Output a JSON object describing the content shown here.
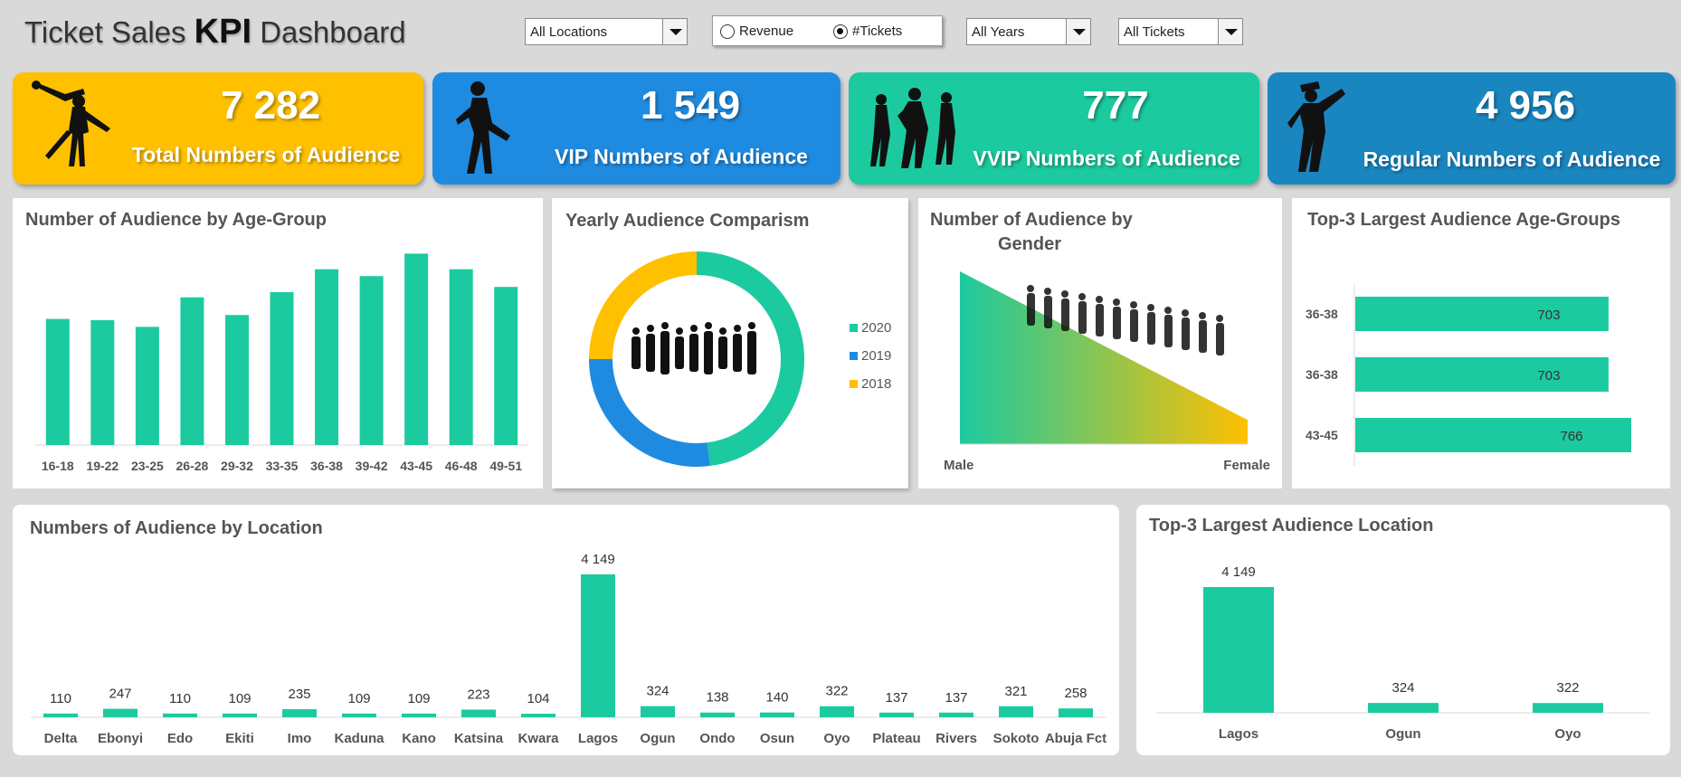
{
  "header": {
    "title_prefix": "Ticket Sales ",
    "title_bold": "KPI",
    "title_suffix": " Dashboard"
  },
  "filters": {
    "location": "All Locations",
    "years": "All Years",
    "tickets": "All Tickets",
    "metric_options": [
      "Revenue",
      "#Tickets"
    ],
    "metric_selected": "#Tickets"
  },
  "kpis": [
    {
      "value": "7 282",
      "label": "Total Numbers of Audience",
      "color": "#ffc000",
      "icon": "couple-dancer-silhouette-icon"
    },
    {
      "value": "1 549",
      "label": "VIP Numbers of Audience",
      "color": "#1f8be0",
      "icon": "male-dancer-silhouette-icon"
    },
    {
      "value": "777",
      "label": "VVIP Numbers of Audience",
      "color": "#1ccaa0",
      "icon": "group-dancers-silhouette-icon"
    },
    {
      "value": "4 956",
      "label": "Regular Numbers of Audience",
      "color": "#1a86c0",
      "icon": "hiphop-dancer-silhouette-icon"
    }
  ],
  "colors": {
    "accent": "#1ccaa0",
    "blue": "#1f8be0",
    "yellow": "#ffc000"
  },
  "chart_data": [
    {
      "id": "age",
      "type": "bar",
      "title": "Number of Audience by Age-Group",
      "categories": [
        "16-18",
        "19-22",
        "23-25",
        "26-28",
        "29-32",
        "33-35",
        "36-38",
        "39-42",
        "43-45",
        "46-48",
        "49-51"
      ],
      "values": [
        606,
        600,
        568,
        710,
        625,
        735,
        845,
        812,
        920,
        845,
        760
      ],
      "ylim": [
        0,
        1000
      ]
    },
    {
      "id": "yearly",
      "type": "pie",
      "title": "Yearly Audience Comparism",
      "labels": [
        "2020",
        "2019",
        "2018"
      ],
      "values": [
        48,
        27,
        25
      ],
      "colors": [
        "#1ccaa0",
        "#1f8be0",
        "#ffc000"
      ]
    },
    {
      "id": "gender",
      "type": "area",
      "title_line1": "Number of Audience by",
      "title_line2": "Gender",
      "categories": [
        "Male",
        "Female"
      ],
      "values": [
        100,
        14
      ],
      "ylim": [
        0,
        100
      ]
    },
    {
      "id": "topage",
      "type": "bar",
      "title": "Top-3 Largest Audience Age-Groups",
      "categories": [
        "36-38",
        "36-38",
        "43-45"
      ],
      "values": [
        703,
        703,
        766
      ],
      "xlim": [
        0,
        800
      ]
    },
    {
      "id": "location",
      "type": "bar",
      "title": "Numbers of Audience by Location",
      "categories": [
        "Delta",
        "Ebonyi",
        "Edo",
        "Ekiti",
        "Imo",
        "Kaduna",
        "Kano",
        "Katsina",
        "Kwara",
        "Lagos",
        "Ogun",
        "Ondo",
        "Osun",
        "Oyo",
        "Plateau",
        "Rivers",
        "Sokoto",
        "Abuja Fct"
      ],
      "values": [
        110,
        247,
        110,
        109,
        235,
        109,
        109,
        223,
        104,
        4149,
        324,
        138,
        140,
        322,
        137,
        137,
        321,
        258
      ],
      "labels": [
        "110",
        "247",
        "110",
        "109",
        "235",
        "109",
        "109",
        "223",
        "104",
        "4 149",
        "324",
        "138",
        "140",
        "322",
        "137",
        "137",
        "321",
        "258"
      ],
      "ylim": [
        0,
        4149
      ]
    },
    {
      "id": "toploc",
      "type": "bar",
      "title": "Top-3 Largest Audience Location",
      "categories": [
        "Lagos",
        "Ogun",
        "Oyo"
      ],
      "values": [
        4149,
        324,
        322
      ],
      "labels": [
        "4 149",
        "324",
        "322"
      ],
      "ylim": [
        0,
        4149
      ]
    }
  ]
}
